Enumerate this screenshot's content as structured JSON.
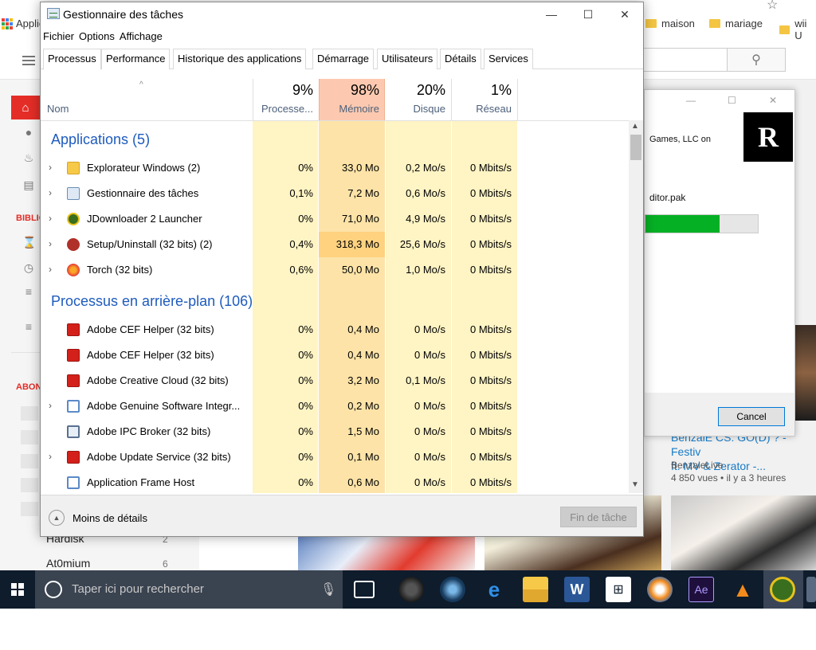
{
  "browser": {
    "apps_label": "Applications",
    "bookmarks": [
      "maison",
      "mariage",
      "wii U"
    ],
    "sidebar": {
      "section_library": "BIBLIOTHÈQUE",
      "section_subs": "ABONNEMENTS",
      "subs": [
        {
          "name": "Hardisk",
          "count": "2"
        },
        {
          "name": "At0mium",
          "count": "6"
        }
      ]
    },
    "video": {
      "title": "BenzaieLive CS:GO ft. MV & Zerator -...",
      "title_line1": "BenzaiE CS: GO(D) ? - Festiv",
      "title_line2": "ft. MV & Zerator -...",
      "channel": "BenzaieLive",
      "meta": "4 850 vues  •  il y a 3 heures"
    },
    "download_dialog": {
      "publisher_text": "Games, LLC on",
      "file_text": "ditor.pak",
      "progress": 0.66,
      "cancel_label": "Cancel"
    }
  },
  "taskmgr": {
    "title": "Gestionnaire des tâches",
    "menu": [
      "Fichier",
      "Options",
      "Affichage"
    ],
    "tabs": [
      "Processus",
      "Performance",
      "Historique des applications",
      "Démarrage",
      "Utilisateurs",
      "Détails",
      "Services"
    ],
    "active_tab": "Processus",
    "columns": {
      "name": "Nom",
      "cpu": {
        "pct": "9%",
        "label": "Processe..."
      },
      "mem": {
        "pct": "98%",
        "label": "Mémoire"
      },
      "disk": {
        "pct": "20%",
        "label": "Disque"
      },
      "net": {
        "pct": "1%",
        "label": "Réseau"
      }
    },
    "groups": [
      {
        "title": "Applications (5)",
        "rows": [
          {
            "name": "Explorateur Windows (2)",
            "cpu": "0%",
            "mem": "33,0 Mo",
            "disk": "0,2 Mo/s",
            "net": "0 Mbits/s",
            "icon": "folder-icon",
            "expandable": true
          },
          {
            "name": "Gestionnaire des tâches",
            "cpu": "0,1%",
            "mem": "7,2 Mo",
            "disk": "0,6 Mo/s",
            "net": "0 Mbits/s",
            "icon": "taskmgr-icon",
            "expandable": true
          },
          {
            "name": "JDownloader 2 Launcher",
            "cpu": "0%",
            "mem": "71,0 Mo",
            "disk": "4,9 Mo/s",
            "net": "0 Mbits/s",
            "icon": "jdownloader-icon",
            "expandable": true
          },
          {
            "name": "Setup/Uninstall (32 bits) (2)",
            "cpu": "0,4%",
            "mem": "318,3 Mo",
            "disk": "25,6 Mo/s",
            "net": "0 Mbits/s",
            "icon": "setup-icon",
            "expandable": true
          },
          {
            "name": "Torch (32 bits)",
            "cpu": "0,6%",
            "mem": "50,0 Mo",
            "disk": "1,0 Mo/s",
            "net": "0 Mbits/s",
            "icon": "torch-icon",
            "expandable": true
          }
        ]
      },
      {
        "title": "Processus en arrière-plan (106)",
        "rows": [
          {
            "name": "Adobe CEF Helper (32 bits)",
            "cpu": "0%",
            "mem": "0,4 Mo",
            "disk": "0 Mo/s",
            "net": "0 Mbits/s",
            "icon": "adobe-cc-icon",
            "expandable": false
          },
          {
            "name": "Adobe CEF Helper (32 bits)",
            "cpu": "0%",
            "mem": "0,4 Mo",
            "disk": "0 Mo/s",
            "net": "0 Mbits/s",
            "icon": "adobe-cc-icon",
            "expandable": false
          },
          {
            "name": "Adobe Creative Cloud (32 bits)",
            "cpu": "0%",
            "mem": "3,2 Mo",
            "disk": "0,1 Mo/s",
            "net": "0 Mbits/s",
            "icon": "adobe-cc-icon",
            "expandable": false
          },
          {
            "name": "Adobe Genuine Software Integr...",
            "cpu": "0%",
            "mem": "0,2 Mo",
            "disk": "0 Mo/s",
            "net": "0 Mbits/s",
            "icon": "app-window-icon",
            "expandable": true
          },
          {
            "name": "Adobe IPC Broker (32 bits)",
            "cpu": "0%",
            "mem": "1,5 Mo",
            "disk": "0 Mo/s",
            "net": "0 Mbits/s",
            "icon": "service-icon",
            "expandable": false
          },
          {
            "name": "Adobe Update Service (32 bits)",
            "cpu": "0%",
            "mem": "0,1 Mo",
            "disk": "0 Mo/s",
            "net": "0 Mbits/s",
            "icon": "adobe-cc-icon",
            "expandable": true
          },
          {
            "name": "Application Frame Host",
            "cpu": "0%",
            "mem": "0,6 Mo",
            "disk": "0 Mo/s",
            "net": "0 Mbits/s",
            "icon": "app-window-icon",
            "expandable": false
          }
        ]
      }
    ],
    "footer": {
      "less_details": "Moins de détails",
      "end_task": "Fin de tâche"
    }
  },
  "taskbar": {
    "search_placeholder": "Taper ici pour rechercher",
    "apps": [
      "task-view-icon",
      "game-icon",
      "steam-icon",
      "edge-icon",
      "file-explorer-icon",
      "word-icon",
      "store-icon",
      "media-player-icon",
      "after-effects-icon",
      "vlc-icon",
      "jdownloader-icon",
      "more-icon"
    ]
  },
  "colors": {
    "accent_blue": "#1e5bbd",
    "mem_highlight": "#ffd27f",
    "cell_bg": "#fff4c4",
    "youtube_red": "#e52d27",
    "progress_green": "#06b025"
  }
}
